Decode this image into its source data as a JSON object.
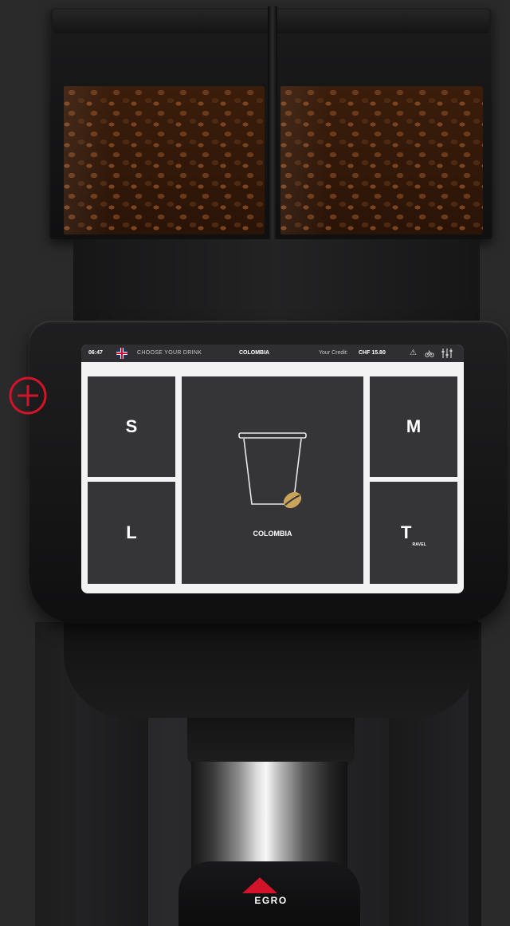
{
  "status_bar": {
    "time": "06:47",
    "language_flag": "uk-flag-icon",
    "choose_label": "CHOOSE YOUR DRINK",
    "product": "COLOMBIA",
    "credit_label": "Your Credit:",
    "credit_value": "CHF 15.80",
    "icons": [
      "alert-triangle-icon",
      "bicycle-icon",
      "settings-sliders-icon"
    ]
  },
  "sizes": {
    "small": "S",
    "medium": "M",
    "large": "L",
    "travel_letter": "T",
    "travel_rest": "RAVEL"
  },
  "center_tile": {
    "product_name": "COLOMBIA",
    "icon": "cup-with-coffee-bean-icon"
  },
  "brand": {
    "logo_text": "EGRO"
  },
  "colors": {
    "accent_red": "#d3132a",
    "bean_gold": "#c9a35a",
    "tile_bg": "#353538"
  }
}
